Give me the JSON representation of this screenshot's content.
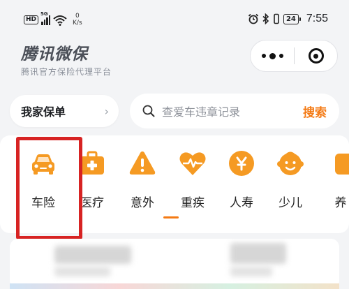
{
  "status_bar": {
    "hd": "HD",
    "network": "5G",
    "speed_value": "0",
    "speed_unit": "K/s",
    "battery": "24",
    "time": "7:55"
  },
  "brand": {
    "title": "腾讯微保",
    "subtitle": "腾讯官方保险代理平台"
  },
  "policy": {
    "label": "我家保单",
    "chevron": "›"
  },
  "search": {
    "placeholder": "查爱车违章记录",
    "button": "搜索"
  },
  "categories": [
    {
      "label": "车险",
      "icon": "car-icon"
    },
    {
      "label": "医疗",
      "icon": "medical-kit-icon"
    },
    {
      "label": "意外",
      "icon": "warning-icon"
    },
    {
      "label": "重疾",
      "icon": "heart-pulse-icon"
    },
    {
      "label": "人寿",
      "icon": "life-badge-icon"
    },
    {
      "label": "少儿",
      "icon": "child-face-icon"
    },
    {
      "label": "养",
      "icon": "elderly-icon"
    }
  ],
  "colors": {
    "accent": "#f47a14",
    "highlight_box": "#d72323",
    "icon_orange": "#f59a23"
  }
}
